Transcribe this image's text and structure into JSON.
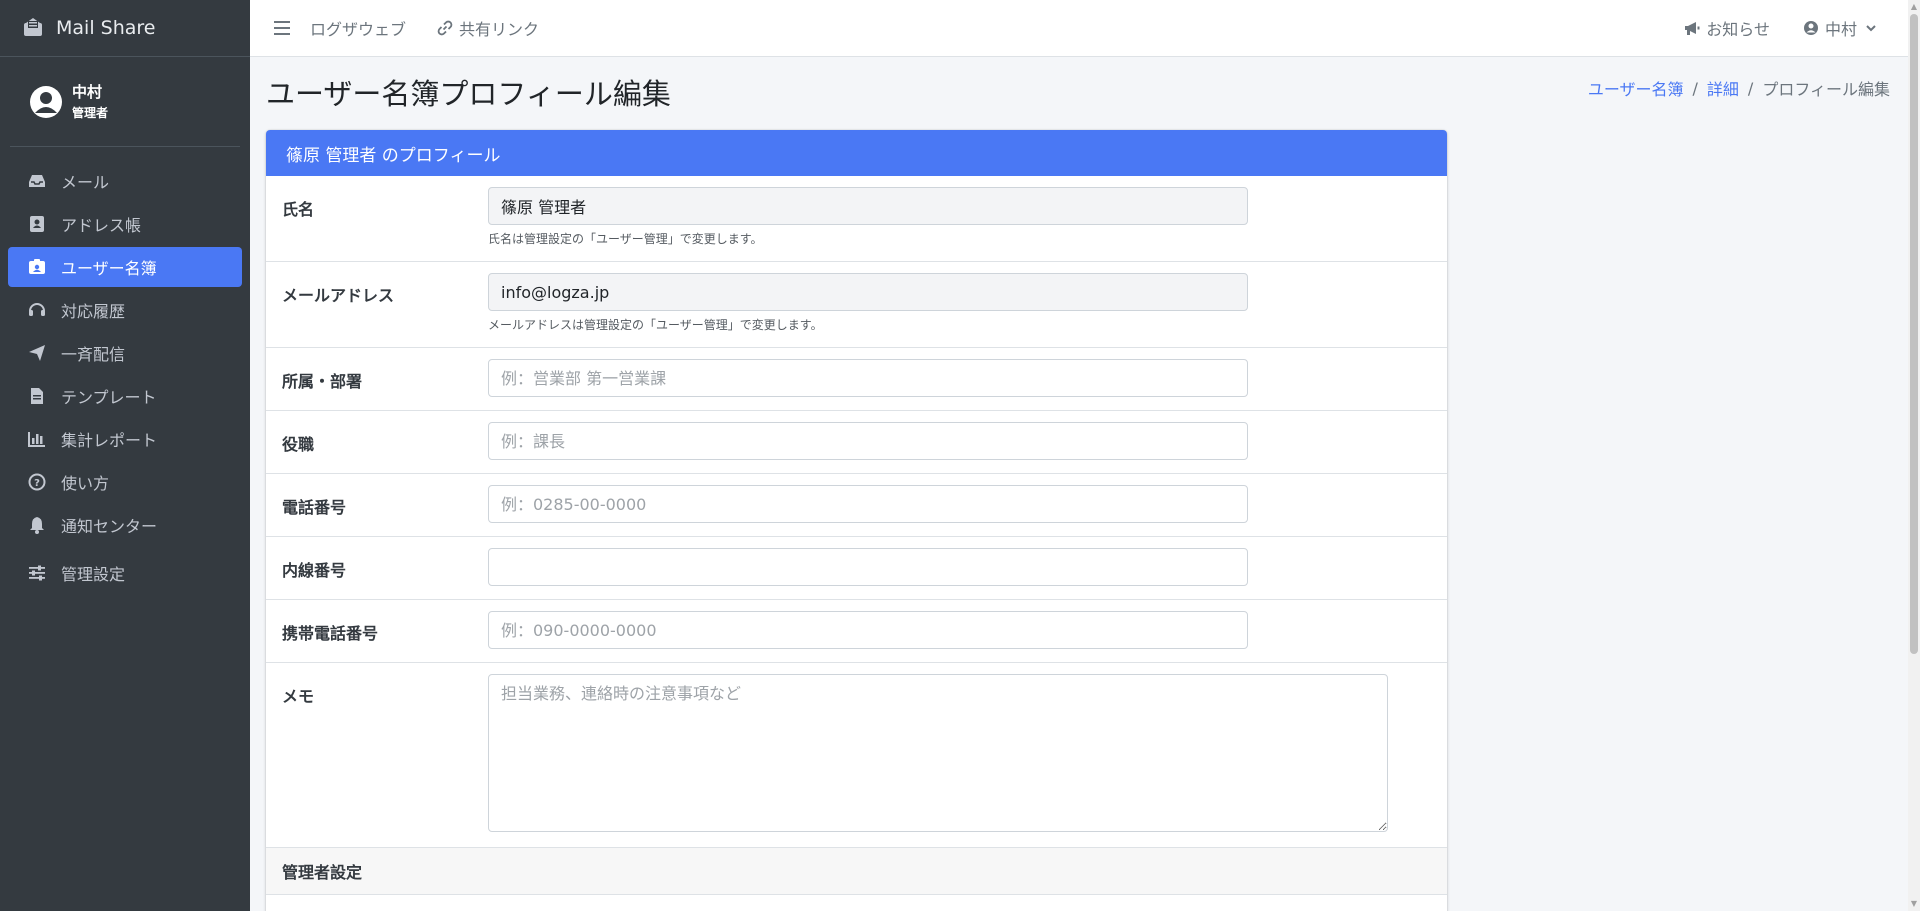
{
  "brand": {
    "name": "Mail Share"
  },
  "user": {
    "name": "中村",
    "role": "管理者"
  },
  "sidebar": {
    "items": [
      {
        "label": "メール",
        "icon": "inbox-icon"
      },
      {
        "label": "アドレス帳",
        "icon": "address-book-icon"
      },
      {
        "label": "ユーザー名簿",
        "icon": "id-badge-icon",
        "active": true
      },
      {
        "label": "対応履歴",
        "icon": "headset-icon"
      },
      {
        "label": "一斉配信",
        "icon": "paper-plane-icon"
      },
      {
        "label": "テンプレート",
        "icon": "file-icon"
      },
      {
        "label": "集計レポート",
        "icon": "chart-bar-icon"
      },
      {
        "label": "使い方",
        "icon": "question-circle-icon"
      },
      {
        "label": "通知センター",
        "icon": "bell-icon"
      },
      {
        "label": "管理設定",
        "icon": "sliders-icon"
      }
    ]
  },
  "topbar": {
    "links": [
      "ログザウェブ",
      "共有リンク"
    ],
    "notice": "お知らせ",
    "user": "中村"
  },
  "page": {
    "title": "ユーザー名簿プロフィール編集",
    "breadcrumb": [
      "ユーザー名簿",
      "詳細",
      "プロフィール編集"
    ]
  },
  "card": {
    "header": "篠原 管理者 のプロフィール",
    "fields": {
      "name": {
        "label": "氏名",
        "value": "篠原 管理者",
        "help": "氏名は管理設定の「ユーザー管理」で変更します。"
      },
      "email": {
        "label": "メールアドレス",
        "value": "info@logza.jp",
        "help": "メールアドレスは管理設定の「ユーザー管理」で変更します。"
      },
      "dept": {
        "label": "所属・部署",
        "placeholder": "例：営業部 第一営業課"
      },
      "position": {
        "label": "役職",
        "placeholder": "例：課長"
      },
      "phone": {
        "label": "電話番号",
        "placeholder": "例：0285-00-0000"
      },
      "extension": {
        "label": "内線番号",
        "placeholder": ""
      },
      "mobile": {
        "label": "携帯電話番号",
        "placeholder": "例：090-0000-0000"
      },
      "memo": {
        "label": "メモ",
        "placeholder": "担当業務、連絡時の注意事項など"
      }
    },
    "admin_section": "管理者設定"
  }
}
